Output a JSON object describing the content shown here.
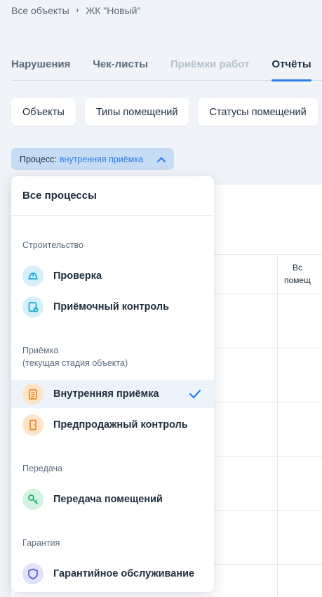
{
  "breadcrumb": {
    "root": "Все объекты",
    "current": "ЖК \"Новый\""
  },
  "tabs": [
    {
      "label": "Нарушения",
      "state": "normal"
    },
    {
      "label": "Чек-листы",
      "state": "normal"
    },
    {
      "label": "Приёмки работ",
      "state": "disabled"
    },
    {
      "label": "Отчёты",
      "state": "active"
    }
  ],
  "filters": {
    "objects": "Объекты",
    "room_types": "Типы помещений",
    "room_statuses": "Статусы помещений"
  },
  "process_filter": {
    "prefix": "Процесс:",
    "value": "внутренняя приёмка"
  },
  "table_header_partial": {
    "line1": "Вс",
    "line2": "помещ"
  },
  "dropdown": {
    "all_label": "Все процессы",
    "groups": [
      {
        "title": "Строительство",
        "subtitle": "",
        "items": [
          {
            "label": "Проверка",
            "icon": "helmet-icon",
            "color": "#21a9d6"
          },
          {
            "label": "Приёмочный контроль",
            "icon": "clipboard-check-icon",
            "color": "#21a9d6"
          }
        ]
      },
      {
        "title": "Приёмка",
        "subtitle": "(текущая стадия объекта)",
        "items": [
          {
            "label": "Внутренняя приёмка",
            "icon": "clipboard-list-icon",
            "color": "#f08a24",
            "selected": true
          },
          {
            "label": "Предпродажный контроль",
            "icon": "door-icon",
            "color": "#f08a24"
          }
        ]
      },
      {
        "title": "Передача",
        "subtitle": "",
        "items": [
          {
            "label": "Передача помещений",
            "icon": "key-icon",
            "color": "#1fae6a"
          }
        ]
      },
      {
        "title": "Гарантия",
        "subtitle": "",
        "items": [
          {
            "label": "Гарантийное обслуживание",
            "icon": "shield-icon",
            "color": "#5b5fd6"
          }
        ]
      }
    ]
  },
  "colors": {
    "accent": "#2b7de9",
    "selected_bg": "#edf3fa"
  }
}
